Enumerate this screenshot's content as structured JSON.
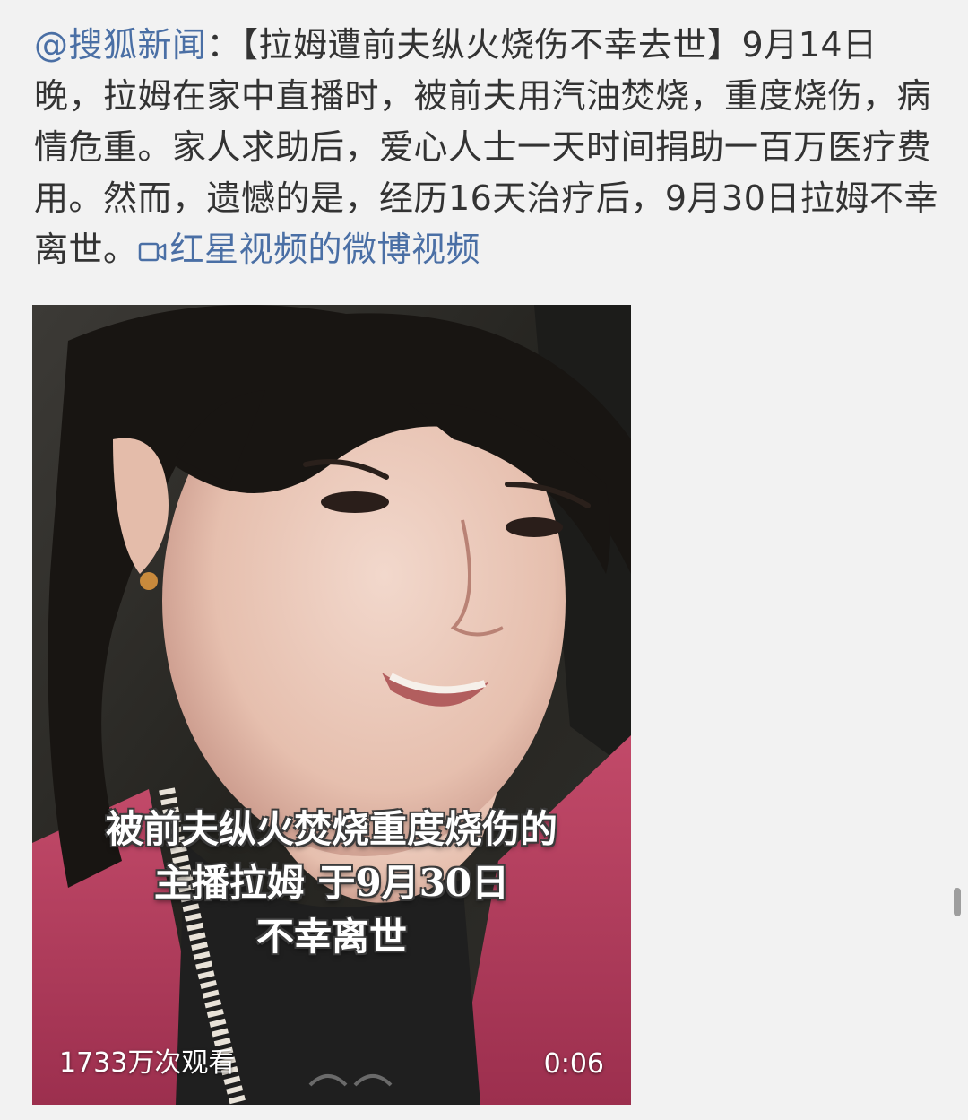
{
  "post": {
    "mention": "@搜狐新闻",
    "separator": "：",
    "body": "【拉姆遭前夫纵火烧伤不幸去世】9月14日晚，拉姆在家中直播时，被前夫用汽油焚烧，重度烧伤，病情危重。家人求助后，爱心人士一天时间捐助一百万医疗费用。然而，遗憾的是，经历16天治疗后，9月30日拉姆不幸离世。",
    "video_link_label": "红星视频的微博视频",
    "video_link_icon": "video-link-icon"
  },
  "video": {
    "caption_lines": [
      "被前夫纵火焚烧重度烧伤的",
      "主播拉姆 于9月30日",
      "不幸离世"
    ],
    "view_count": "1733万次观看",
    "duration": "0:06",
    "colors": {
      "link": "#4a6fa5",
      "text": "#333333",
      "jacket": "#b8405f"
    }
  }
}
